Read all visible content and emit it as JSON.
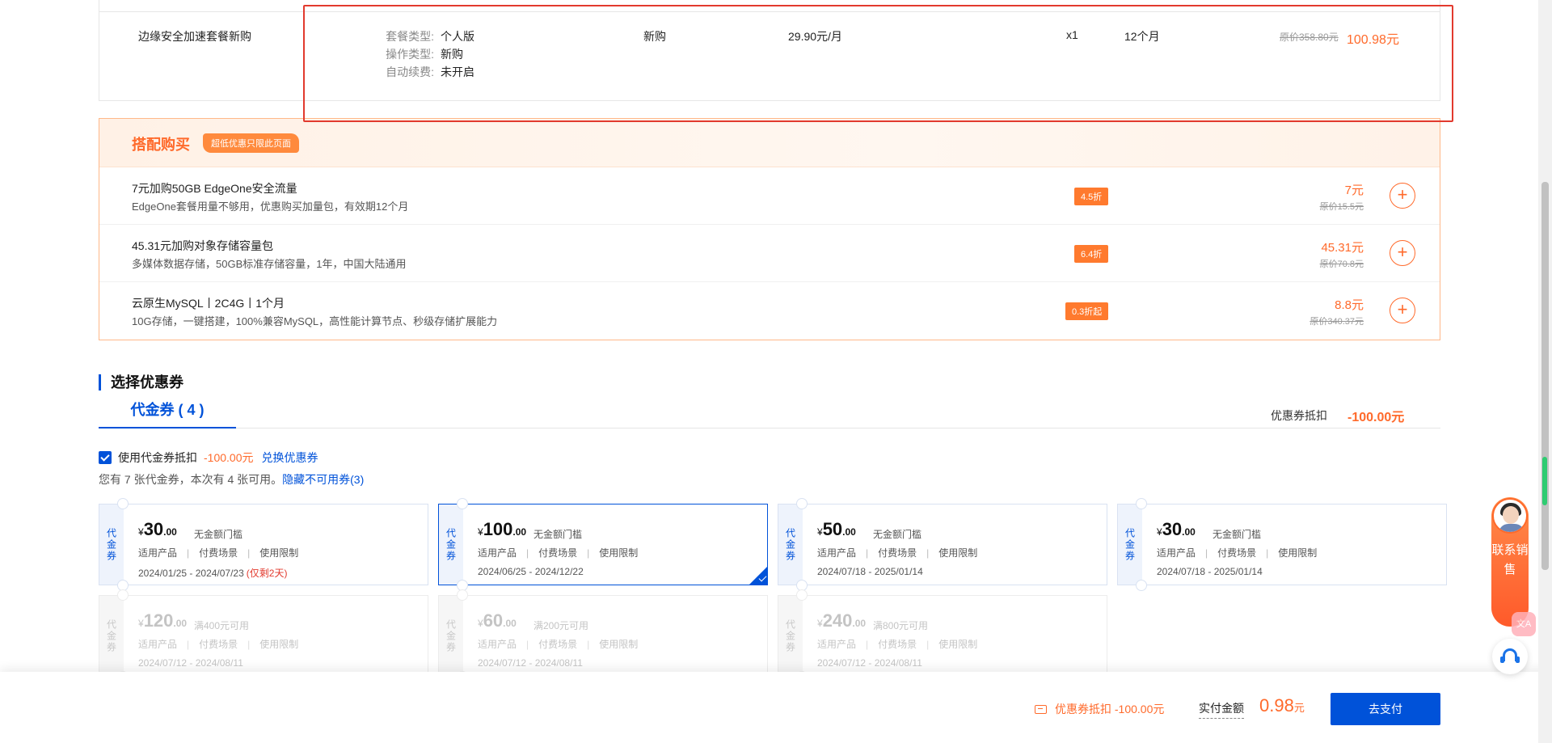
{
  "order": {
    "name": "边缘安全加速套餐新购",
    "specs": [
      {
        "key": "套餐类型:",
        "value": "个人版"
      },
      {
        "key": "操作类型:",
        "value": "新购"
      },
      {
        "key": "自动续费:",
        "value": "未开启"
      }
    ],
    "type": "新购",
    "unit_price": "29.90元/月",
    "quantity": "x1",
    "duration": "12个月",
    "original_price": "原价358.80元",
    "price": "100.98元"
  },
  "bundle": {
    "title": "搭配购买",
    "badge": "超低优惠只限此页面",
    "items": [
      {
        "name": "7元加购50GB EdgeOne安全流量",
        "desc": "EdgeOne套餐用量不够用，优惠购买加量包，有效期12个月",
        "discount": "4.5折",
        "price": "7元",
        "original": "原价15.5元"
      },
      {
        "name": "45.31元加购对象存储容量包",
        "desc": "多媒体数据存储，50GB标准存储容量，1年，中国大陆通用",
        "discount": "6.4折",
        "price": "45.31元",
        "original": "原价70.8元"
      },
      {
        "name": "云原生MySQL丨2C4G丨1个月",
        "desc": "10G存储，一键搭建，100%兼容MySQL，高性能计算节点、秒级存储扩展能力",
        "discount": "0.3折起",
        "price": "8.8元",
        "original": "原价340.37元"
      }
    ]
  },
  "coupons": {
    "section_title": "选择优惠券",
    "tab_label": "代金券 ( 4 )",
    "deduct_label": "优惠券抵扣",
    "deduct_value": "-100.00元",
    "use_label": "使用代金券抵扣",
    "use_amount": "-100.00元",
    "exchange_link": "兑换优惠券",
    "avail_text": "您有 7 张代金券，本次有 4 张可用。",
    "hide_link": "隐藏不可用券(3)",
    "side_label": "代金券",
    "meta": {
      "products": "适用产品",
      "scene": "付费场景",
      "limit": "使用限制"
    },
    "list": [
      {
        "int": "30",
        "dec": ".00",
        "cond": "无金额门槛",
        "date": "2024/01/25 - 2024/07/23",
        "warn": "(仅剩2天)",
        "selected": false,
        "disabled": false
      },
      {
        "int": "100",
        "dec": ".00",
        "cond": "无金额门槛",
        "date": "2024/06/25 - 2024/12/22",
        "warn": "",
        "selected": true,
        "disabled": false
      },
      {
        "int": "50",
        "dec": ".00",
        "cond": "无金额门槛",
        "date": "2024/07/18 - 2025/01/14",
        "warn": "",
        "selected": false,
        "disabled": false
      },
      {
        "int": "30",
        "dec": ".00",
        "cond": "无金额门槛",
        "date": "2024/07/18 - 2025/01/14",
        "warn": "",
        "selected": false,
        "disabled": false
      },
      {
        "int": "120",
        "dec": ".00",
        "cond": "满400元可用",
        "date": "2024/07/12 - 2024/08/11",
        "warn": "",
        "selected": false,
        "disabled": true
      },
      {
        "int": "60",
        "dec": ".00",
        "cond": "满200元可用",
        "date": "2024/07/12 - 2024/08/11",
        "warn": "",
        "selected": false,
        "disabled": true
      },
      {
        "int": "240",
        "dec": ".00",
        "cond": "满800元可用",
        "date": "2024/07/12 - 2024/08/11",
        "warn": "",
        "selected": false,
        "disabled": true
      }
    ]
  },
  "footer": {
    "coupon_text": "优惠券抵扣 -100.00元",
    "total_label": "实付金额",
    "total_value": "0.98",
    "total_unit": "元",
    "pay_label": "去支付"
  },
  "floating": {
    "sales_text": "联系销售",
    "lang_badge": "文A"
  },
  "colors": {
    "accent": "#0052d9",
    "price": "#ff6a2b",
    "highlight_box": "#e23a2e"
  }
}
